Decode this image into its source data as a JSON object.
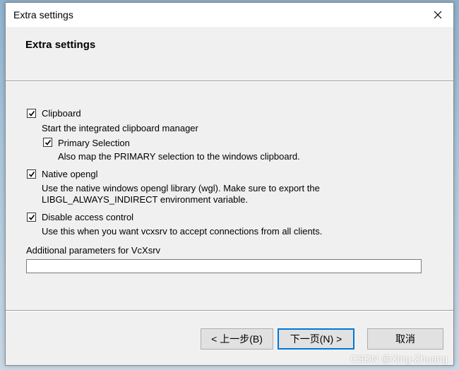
{
  "window": {
    "title": "Extra settings"
  },
  "header": {
    "title": "Extra settings"
  },
  "options": {
    "clipboard": {
      "label": "Clipboard",
      "checked": true,
      "description": "Start the integrated clipboard manager"
    },
    "primary_selection": {
      "label": "Primary Selection",
      "checked": true,
      "description": "Also map the PRIMARY selection to the windows clipboard."
    },
    "native_opengl": {
      "label": "Native opengl",
      "checked": true,
      "description_line1": "Use the native windows opengl library (wgl). Make sure to export the",
      "description_line2": "LIBGL_ALWAYS_INDIRECT environment variable."
    },
    "disable_access_control": {
      "label": "Disable access control",
      "checked": true,
      "description": "Use this when you want vcxsrv to accept connections from all clients."
    }
  },
  "additional_params": {
    "label": "Additional parameters for VcXsrv",
    "value": ""
  },
  "buttons": {
    "back": "< 上一步(B)",
    "next": "下一页(N) >",
    "cancel": "取消"
  },
  "watermark": "CSDN @Xing-Zhuang"
}
